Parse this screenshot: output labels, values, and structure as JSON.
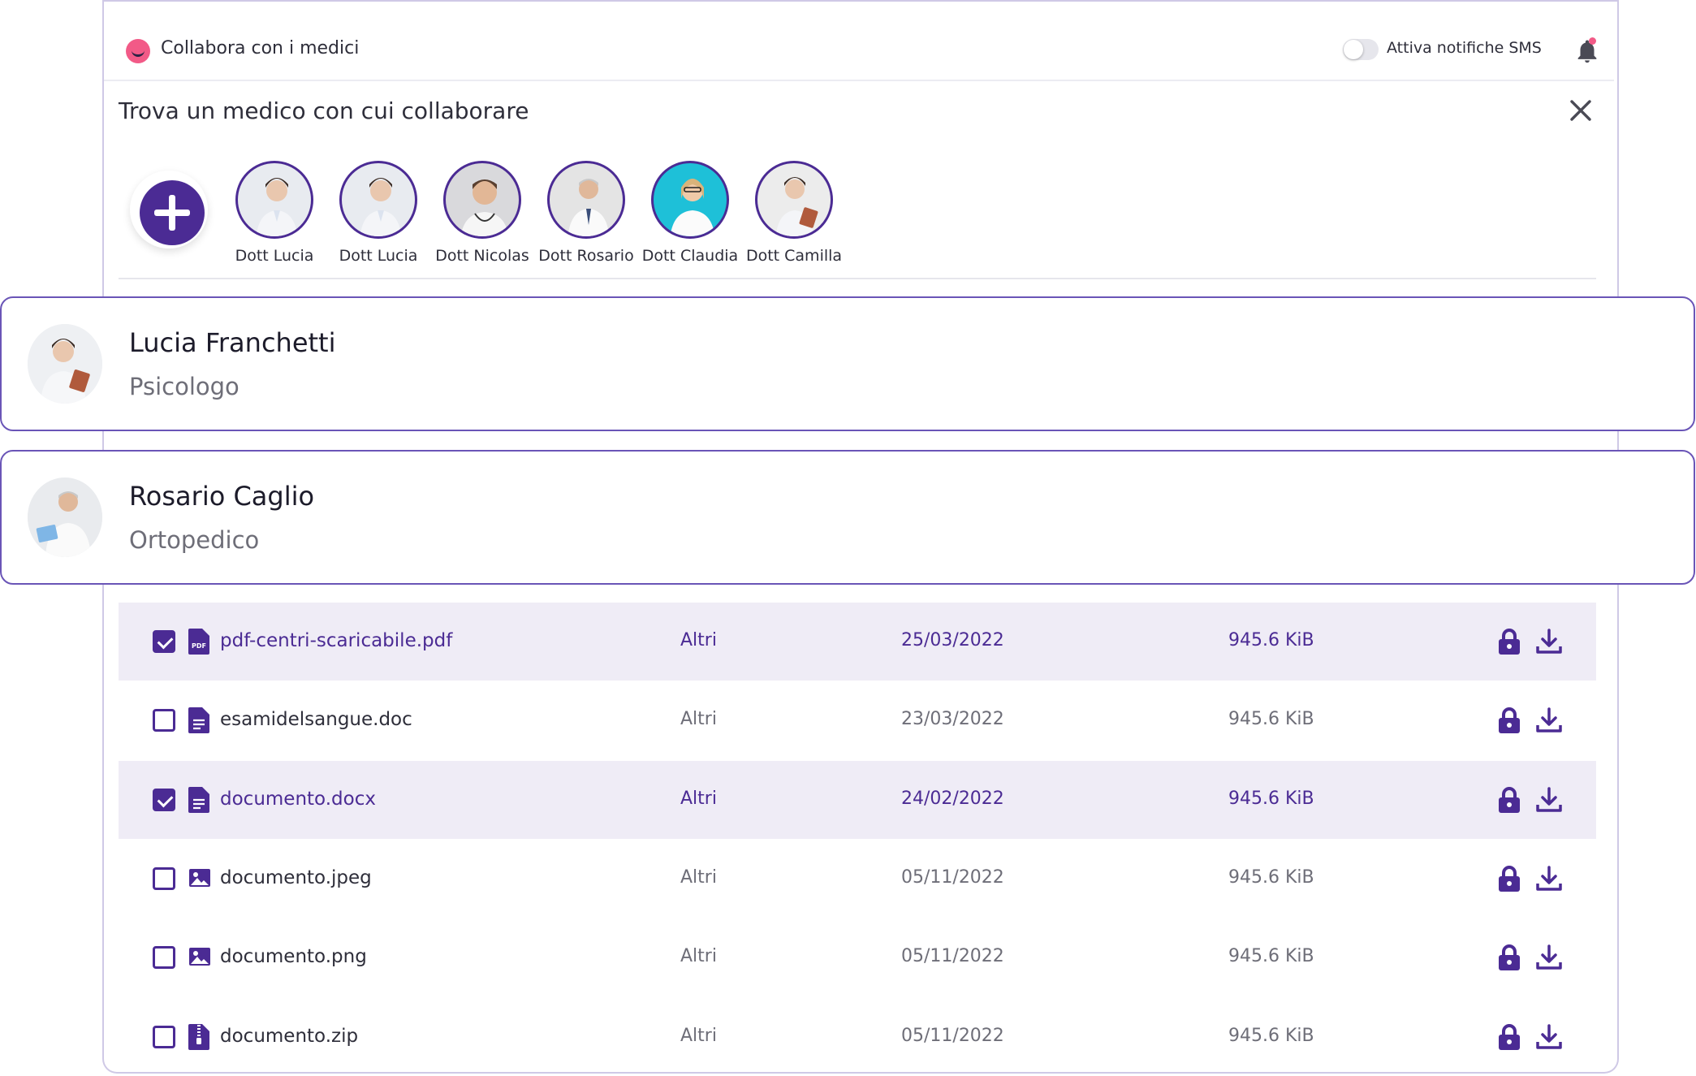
{
  "header": {
    "app_title": "Collabora con i medici",
    "sms_toggle_label": "Attiva notifiche SMS",
    "sms_enabled": false
  },
  "finder": {
    "title": "Trova un medico con cui collaborare",
    "doctors": [
      {
        "name": "Dott Lucia",
        "avatar": "female-doctor"
      },
      {
        "name": "Dott Lucia",
        "avatar": "female-doctor"
      },
      {
        "name": "Dott Nicolas",
        "avatar": "male-doctor"
      },
      {
        "name": "Dott Rosario",
        "avatar": "senior-male-doctor"
      },
      {
        "name": "Dott Claudia",
        "avatar": "female-doctor-teal"
      },
      {
        "name": "Dott Camilla",
        "avatar": "female-doctor-tablet"
      }
    ]
  },
  "cards": [
    {
      "name": "Lucia Franchetti",
      "role": "Psicologo"
    },
    {
      "name": "Rosario Caglio",
      "role": "Ortopedico"
    }
  ],
  "files": [
    {
      "name": "pdf-centri-scaricabile.pdf",
      "icon": "pdf-file-icon",
      "category": "Altri",
      "date": "25/03/2022",
      "size": "945.6 KiB",
      "selected": true
    },
    {
      "name": "esamidelsangue.doc",
      "icon": "document-file-icon",
      "category": "Altri",
      "date": "23/03/2022",
      "size": "945.6 KiB",
      "selected": false
    },
    {
      "name": "documento.docx",
      "icon": "document-file-icon",
      "category": "Altri",
      "date": "24/02/2022",
      "size": "945.6 KiB",
      "selected": true
    },
    {
      "name": "documento.jpeg",
      "icon": "image-file-icon",
      "category": "Altri",
      "date": "05/11/2022",
      "size": "945.6 KiB",
      "selected": false
    },
    {
      "name": "documento.png",
      "icon": "image-file-icon",
      "category": "Altri",
      "date": "05/11/2022",
      "size": "945.6 KiB",
      "selected": false
    },
    {
      "name": "documento.zip",
      "icon": "zip-file-icon",
      "category": "Altri",
      "date": "05/11/2022",
      "size": "945.6 KiB",
      "selected": false
    }
  ],
  "colors": {
    "accent": "#4b2b94",
    "selected_row": "#efecf6",
    "brand_pink": "#f25a87",
    "card_border": "#6a55b7"
  }
}
